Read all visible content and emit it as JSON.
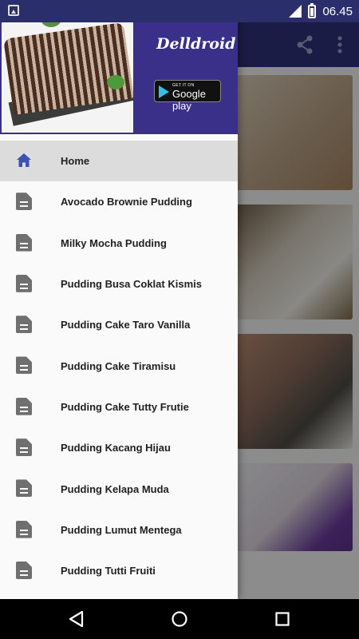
{
  "status_bar": {
    "time": "06.45"
  },
  "app_bar": {
    "share_icon": "share-icon",
    "overflow_icon": "more-vert-icon"
  },
  "drawer": {
    "brand": "Delldroid",
    "play_badge": {
      "small": "GET IT ON",
      "big": "Google play"
    },
    "items": [
      {
        "label": "Home",
        "icon": "home-icon",
        "active": true
      },
      {
        "label": "Avocado Brownie Pudding",
        "icon": "document-icon"
      },
      {
        "label": "Milky Mocha Pudding",
        "icon": "document-icon"
      },
      {
        "label": "Pudding Busa Coklat Kismis",
        "icon": "document-icon"
      },
      {
        "label": "Pudding Cake Taro Vanilla",
        "icon": "document-icon"
      },
      {
        "label": "Pudding Cake Tiramisu",
        "icon": "document-icon"
      },
      {
        "label": "Pudding Cake Tutty Frutie",
        "icon": "document-icon"
      },
      {
        "label": "Pudding Kacang Hijau",
        "icon": "document-icon"
      },
      {
        "label": "Pudding Kelapa Muda",
        "icon": "document-icon"
      },
      {
        "label": "Pudding Lumut Mentega",
        "icon": "document-icon"
      },
      {
        "label": "Pudding Tutti Fruiti",
        "icon": "document-icon"
      }
    ]
  },
  "colors": {
    "primary": "#2d3178",
    "drawer_header": "#3a3089",
    "home_icon": "#3f51b5"
  }
}
